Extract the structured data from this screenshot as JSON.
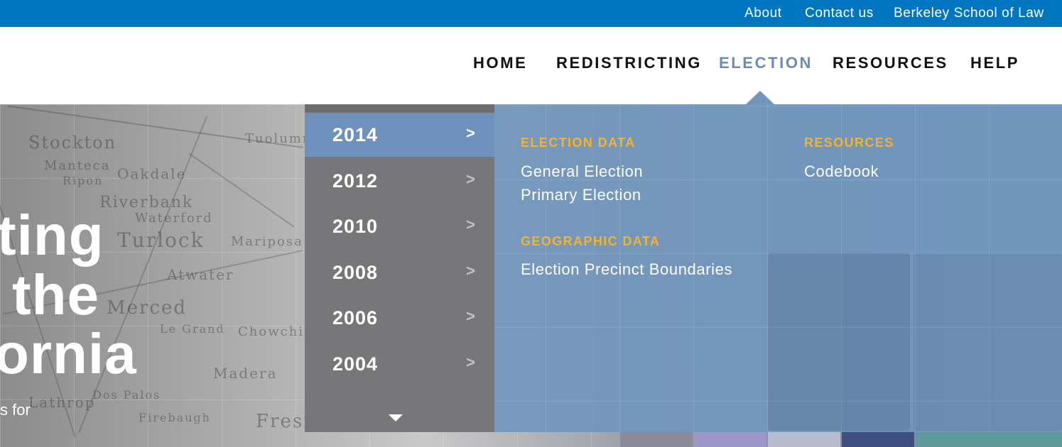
{
  "topbar": {
    "links": [
      "About",
      "Contact us",
      "Berkeley School of Law"
    ]
  },
  "nav": {
    "items": [
      "HOME",
      "REDISTRICTING",
      "ELECTION",
      "RESOURCES",
      "HELP"
    ],
    "active": "ELECTION"
  },
  "hero": {
    "title_lines": [
      "ting",
      "the",
      "ornia"
    ],
    "subtitle": "s for",
    "map_labels": [
      "Stockton",
      "Manteca",
      "Oakdale",
      "Riverbank",
      "Waterford",
      "Turlock",
      "Mariposa",
      "Atwater",
      "Merced",
      "Tuolumne",
      "Madera",
      "Dos Palos",
      "Firebaugh",
      "Fresno",
      "Lathrop",
      "Le Grand",
      "Chowchilla",
      "Ripon"
    ]
  },
  "dropdown": {
    "years": [
      "2014",
      "2012",
      "2010",
      "2008",
      "2006",
      "2004"
    ],
    "active_year": "2014",
    "chevron": ">",
    "sections": {
      "election_data": {
        "heading": "ELECTION DATA",
        "links": [
          "General Election",
          "Primary Election"
        ]
      },
      "geographic_data": {
        "heading": "GEOGRAPHIC DATA",
        "links": [
          "Election Precinct Boundaries"
        ]
      },
      "resources": {
        "heading": "RESOURCES",
        "links": [
          "Codebook"
        ]
      }
    }
  },
  "colors": {
    "topbar": "#0176c0",
    "active_nav": "#6b8db3",
    "year_active": "#6e92bd",
    "year_bg": "#777678",
    "panel_bg": "#7096be",
    "section_head": "#f2b330"
  },
  "icons": {
    "year_chevron": "chevron-right-icon",
    "scroll_down": "caret-down-icon"
  }
}
